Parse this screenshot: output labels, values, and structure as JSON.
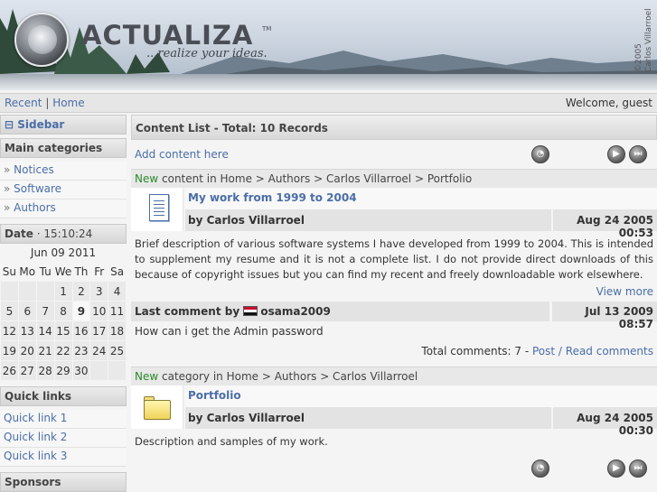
{
  "header": {
    "brand": "ACTUALIZA",
    "trademark": "TM",
    "tagline": "...realize your ideas.",
    "copyright_year": "©2005",
    "copyright_name": "Carlos Villarroel"
  },
  "topbar": {
    "recent": "Recent",
    "separator": "|",
    "home": "Home",
    "welcome": "Welcome, guest"
  },
  "sidebar": {
    "toggle_symbol": "⊟",
    "title": "Sidebar",
    "main_categories": {
      "title": "Main categories",
      "items": [
        {
          "label": "Notices"
        },
        {
          "label": "Software"
        },
        {
          "label": "Authors"
        }
      ]
    },
    "date": {
      "label": "Date",
      "time": "15:10:24",
      "month": "Jun 09 2011",
      "weekdays": [
        "Su",
        "Mo",
        "Tu",
        "We",
        "Th",
        "Fr",
        "Sa"
      ],
      "today": 9
    },
    "quick_links": {
      "title": "Quick links",
      "items": [
        {
          "label": "Quick link 1"
        },
        {
          "label": "Quick link 2"
        },
        {
          "label": "Quick link 3"
        }
      ]
    },
    "sponsors": {
      "title": "Sponsors"
    }
  },
  "main": {
    "list_title": "Content List - Total: 10 Records",
    "add_content": "Add content here",
    "item1": {
      "crumb_new": "New",
      "crumb_rest": " content in Home > Authors > Carlos Villarroel > Portfolio",
      "title": "My work from 1999 to 2004",
      "author": "by Carlos Villarroel",
      "date": "Aug 24 2005 00:53",
      "description": "Brief description of various software systems I have developed from 1999 to 2004. This is intended to supplement my resume and it is not a complete list. I do not provide direct downloads of this because of copyright issues but you can find my recent and freely downloadable work elsewhere.",
      "view_more": "View more",
      "last_comment_label": "Last comment by",
      "last_comment_user": "osama2009",
      "last_comment_date": "Jul 13 2009 08:57",
      "comment_text": "How can i get the Admin password",
      "total_comments": "Total comments: 7 - ",
      "post_read": "Post / Read comments"
    },
    "item2": {
      "crumb_new": "New",
      "crumb_rest": " category in Home > Authors > Carlos Villarroel",
      "title": "Portfolio",
      "author": "by Carlos Villarroel",
      "date": "Aug 24 2005 00:30",
      "description": "Description and samples of my work."
    }
  }
}
